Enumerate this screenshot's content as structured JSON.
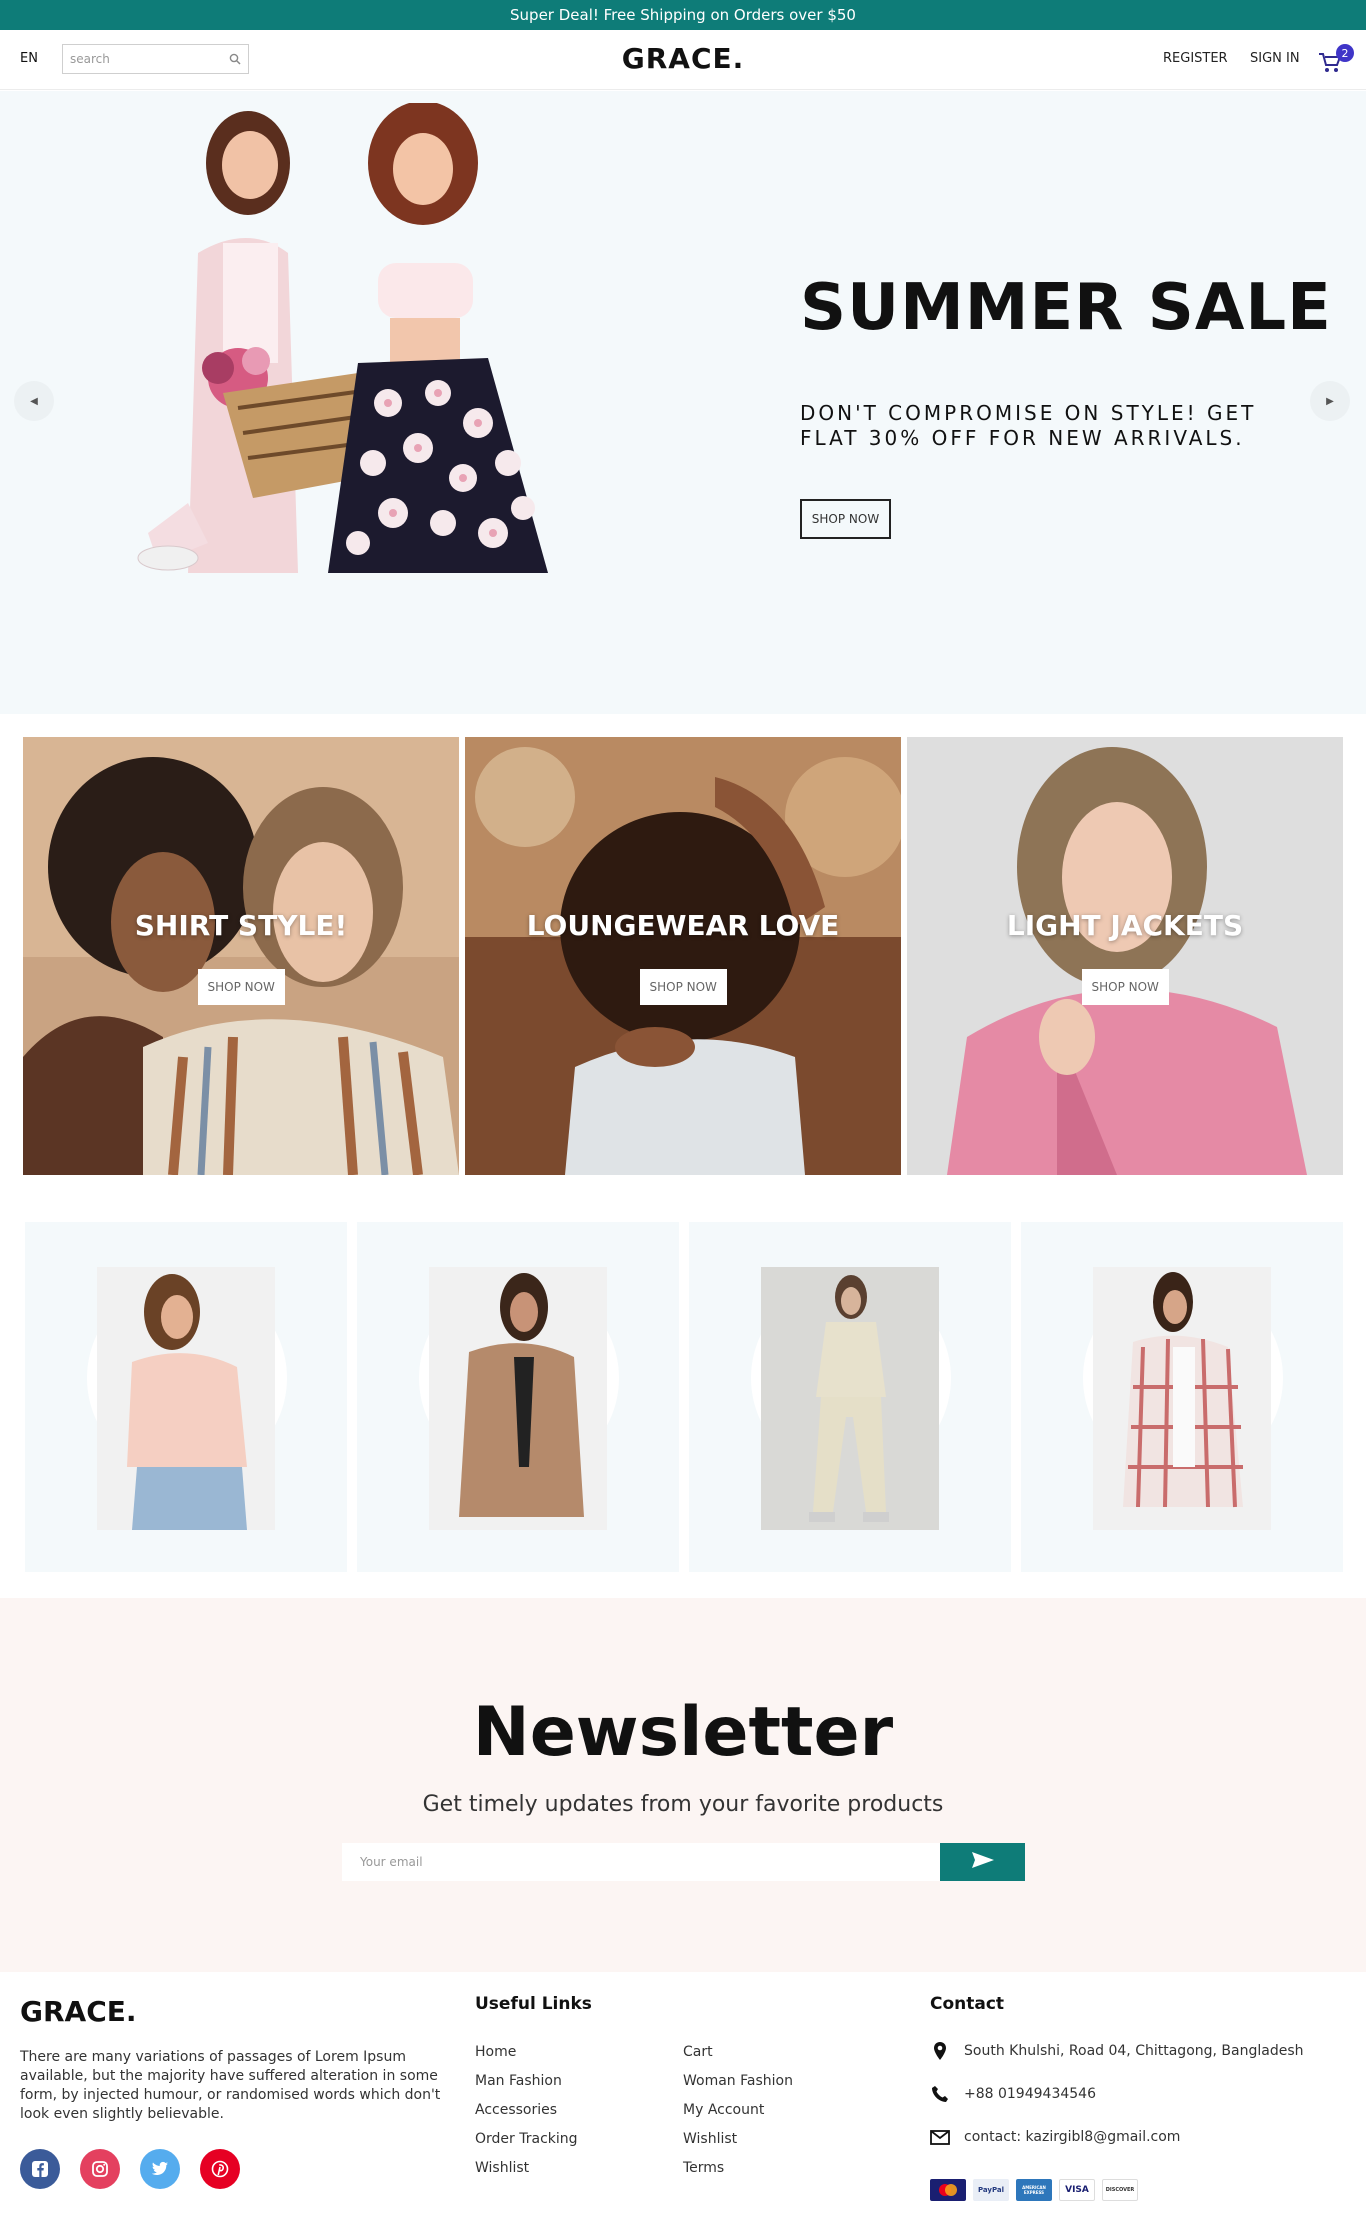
{
  "announcement": "Super Deal! Free Shipping on Orders over $50",
  "navbar": {
    "language": "EN",
    "search_placeholder": "search",
    "logo": "GRACE.",
    "register": "REGISTER",
    "sign_in": "SIGN IN",
    "cart_count": "2",
    "cart_icon": "shopping-cart-icon",
    "search_icon": "magnifier-icon"
  },
  "hero": {
    "title": "SUMMER SALE",
    "description": "DON'T COMPROMISE ON STYLE! GET FLAT 30% OFF FOR NEW ARRIVALS.",
    "button": "SHOP NOW",
    "left_arrow_icon": "arrow-left-icon",
    "right_arrow_icon": "arrow-right-icon"
  },
  "categories": [
    {
      "title": "SHIRT STYLE!",
      "button": "SHOP NOW"
    },
    {
      "title": "LOUNGEWEAR LOVE",
      "button": "SHOP NOW"
    },
    {
      "title": "LIGHT JACKETS",
      "button": "SHOP NOW"
    }
  ],
  "products_count": 4,
  "newsletter": {
    "title": "Newsletter",
    "subtitle": "Get timely updates from your favorite products",
    "email_placeholder": "Your email",
    "send_icon": "send-icon"
  },
  "footer": {
    "logo": "GRACE.",
    "description": "There are many variations of passages of Lorem Ipsum available, but the majority have suffered alteration in some form, by injected humour, or randomised words which don't look even slightly believable.",
    "social_icons": [
      "facebook-icon",
      "instagram-icon",
      "twitter-icon",
      "pinterest-icon"
    ],
    "useful_links_title": "Useful Links",
    "links_col1": [
      "Home",
      "Man Fashion",
      "Accessories",
      "Order Tracking",
      "Wishlist"
    ],
    "links_col2": [
      "Cart",
      "Woman Fashion",
      "My Account",
      "Wishlist",
      "Terms"
    ],
    "contact_title": "Contact",
    "address": "South Khulshi, Road 04, Chittagong, Bangladesh",
    "phone": "+88 01949434546",
    "email": "contact: kazirgibl8@gmail.com",
    "payment_methods": [
      "MasterCard",
      "PayPal",
      "AMERICAN EXPRESS",
      "VISA",
      "DISCOVER"
    ]
  },
  "colors": {
    "accent": "#0e7c78",
    "hero_bg": "#f4f9fb",
    "newsletter_bg": "#fcf5f3",
    "cart_badge": "#3f35c8"
  }
}
